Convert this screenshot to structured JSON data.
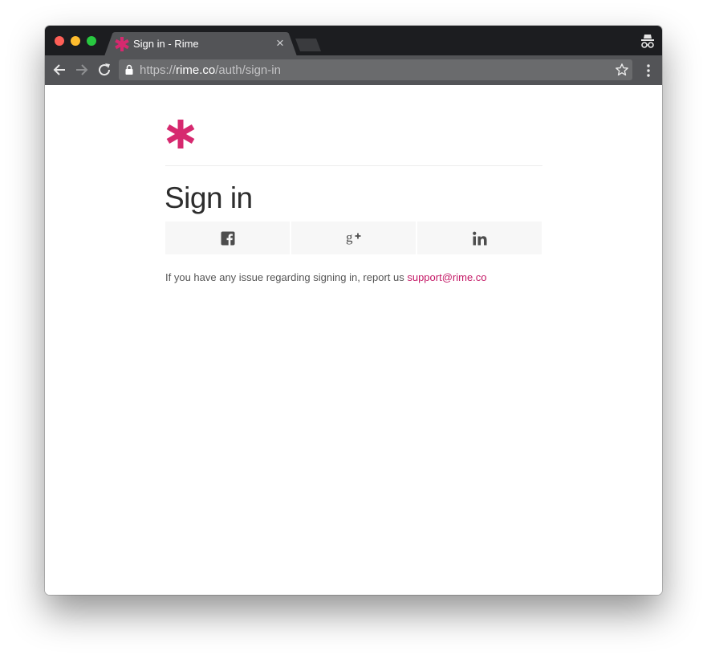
{
  "browser": {
    "tab": {
      "title": "Sign in - Rime",
      "close_glyph": "×",
      "favicon": "asterisk-icon"
    },
    "address": {
      "scheme": "https://",
      "host": "rime.co",
      "path": "/auth/sign-in"
    },
    "icons": [
      "back-icon",
      "forward-icon",
      "reload-icon",
      "lock-icon",
      "star-icon",
      "menu-icon",
      "incognito-icon"
    ]
  },
  "page": {
    "title": "Sign in",
    "social_buttons": [
      {
        "provider": "facebook",
        "icon": "facebook-icon"
      },
      {
        "provider": "google-plus",
        "icon": "google-plus-icon"
      },
      {
        "provider": "linkedin",
        "icon": "linkedin-icon"
      }
    ],
    "support_text": "If you have any issue regarding signing in, report us ",
    "support_link": "support@rime.co"
  },
  "colors": {
    "brand": "#d6296f",
    "link": "#c41765",
    "title": "#2d2d2d",
    "button_bg": "#f7f7f7"
  }
}
